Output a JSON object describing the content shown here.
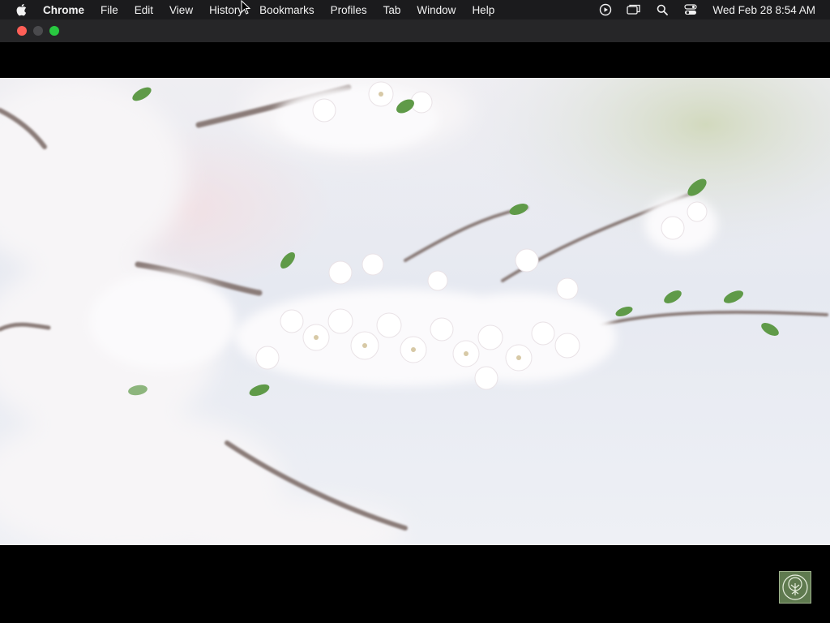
{
  "menubar": {
    "apple_icon": "apple-logo-icon",
    "app_name": "Chrome",
    "items": [
      "File",
      "Edit",
      "View",
      "History",
      "Bookmarks",
      "Profiles",
      "Tab",
      "Window",
      "Help"
    ],
    "status_icons": [
      "screen-recording-icon",
      "screen-mirroring-icon",
      "search-icon",
      "control-center-icon"
    ],
    "clock": "Wed Feb 28  8:54 AM"
  },
  "window": {
    "traffic_lights": {
      "close_color": "#fe5f57",
      "minimize_color": "#4a4a4d",
      "zoom_color": "#28c840"
    }
  },
  "video": {
    "content": "cherry-blossom-branches",
    "background": "#000000"
  },
  "channel_logo": {
    "icon": "tree-logo-icon",
    "color": "#5f7a4f"
  }
}
